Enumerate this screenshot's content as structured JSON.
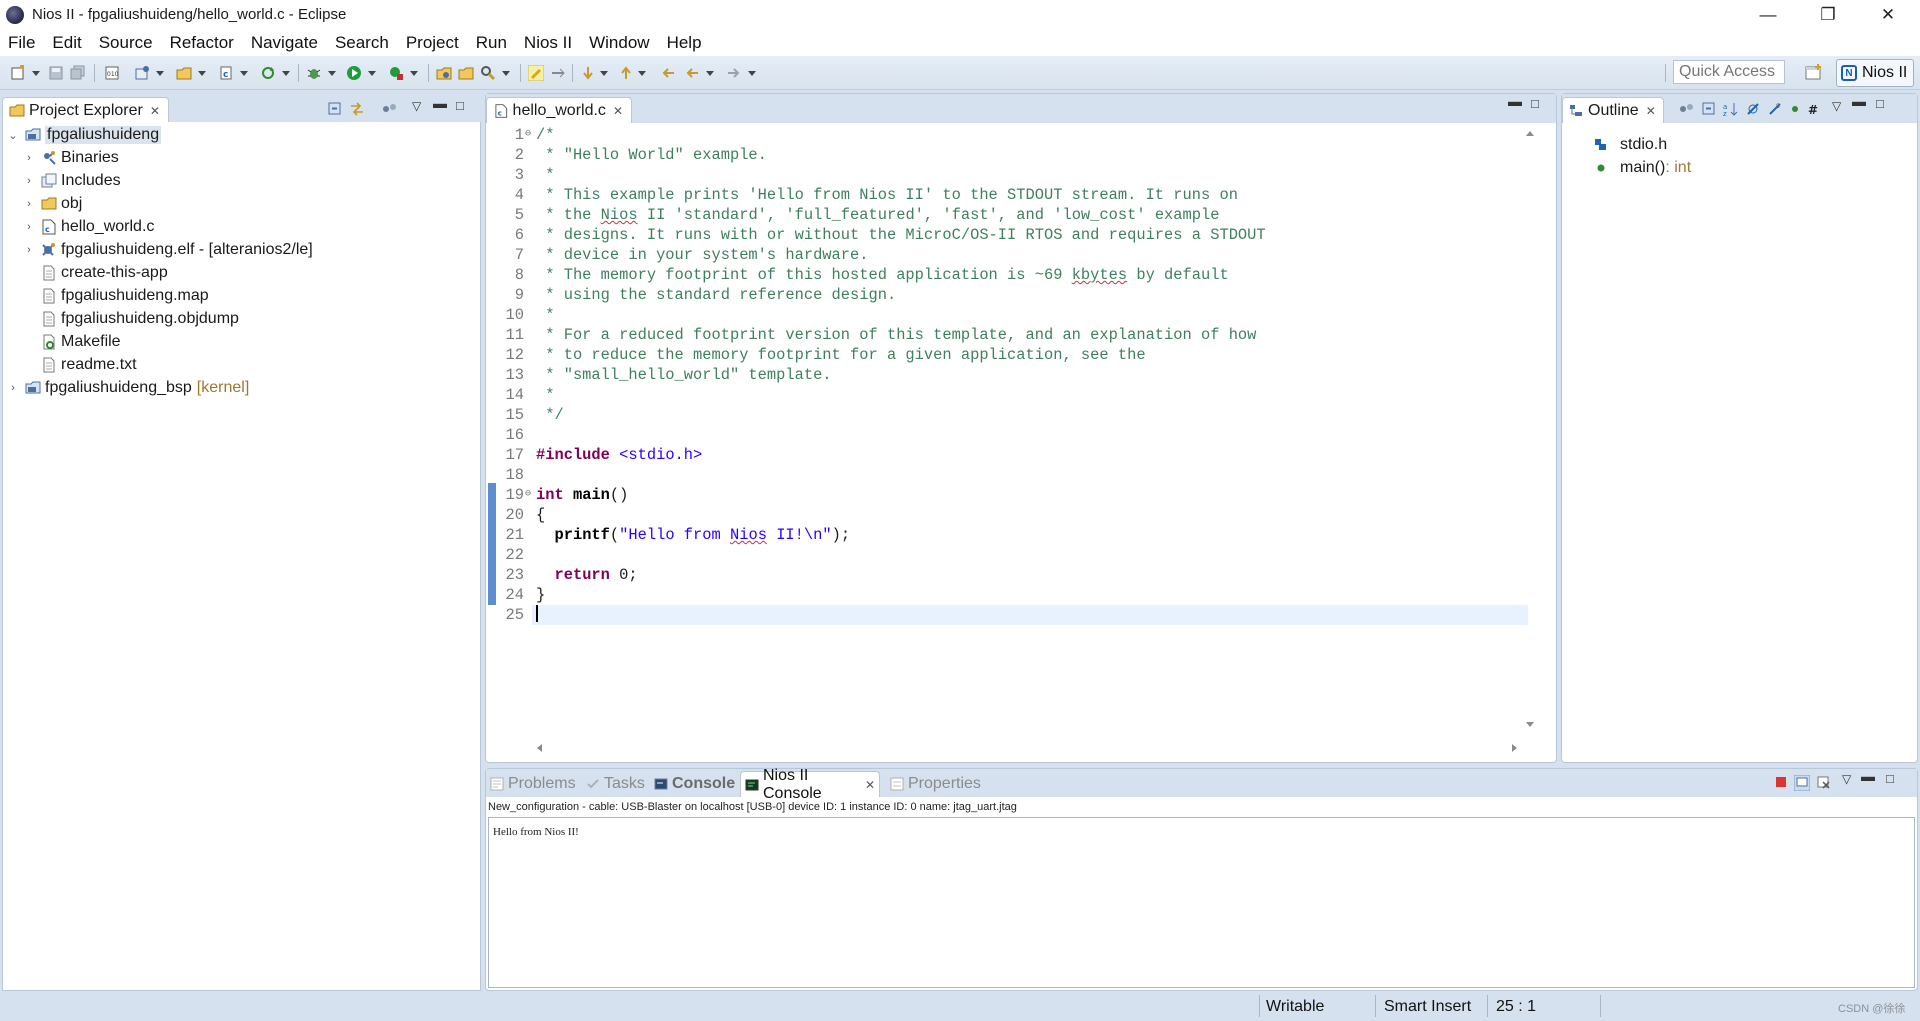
{
  "window": {
    "title": "Nios II - fpgaliushuideng/hello_world.c - Eclipse",
    "minimize": "—",
    "restore": "❐",
    "close": "✕"
  },
  "menu": [
    "File",
    "Edit",
    "Source",
    "Refactor",
    "Navigate",
    "Search",
    "Project",
    "Run",
    "Nios II",
    "Window",
    "Help"
  ],
  "toolbar": {
    "quick_access_placeholder": "Quick Access",
    "perspective_label": "Nios II",
    "perspective_icon_text": "N"
  },
  "project_explorer": {
    "title": "Project Explorer",
    "tree": [
      {
        "label": "fpgaliushuideng",
        "icon": "project-folder-icon",
        "expanded": true,
        "selected": true,
        "level": 0,
        "chevron": "⌄"
      },
      {
        "label": "Binaries",
        "icon": "binaries-icon",
        "level": 1,
        "chevron": "›"
      },
      {
        "label": "Includes",
        "icon": "includes-icon",
        "level": 1,
        "chevron": "›"
      },
      {
        "label": "obj",
        "icon": "folder-icon",
        "level": 1,
        "chevron": "›"
      },
      {
        "label": "hello_world.c",
        "icon": "c-file-icon",
        "level": 1,
        "chevron": "›"
      },
      {
        "label": "fpgaliushuideng.elf - [alteranios2/le]",
        "icon": "elf-icon",
        "level": 1,
        "chevron": "›"
      },
      {
        "label": "create-this-app",
        "icon": "file-icon",
        "level": 1,
        "chevron": ""
      },
      {
        "label": "fpgaliushuideng.map",
        "icon": "file-icon",
        "level": 1,
        "chevron": ""
      },
      {
        "label": "fpgaliushuideng.objdump",
        "icon": "file-icon",
        "level": 1,
        "chevron": ""
      },
      {
        "label": "Makefile",
        "icon": "makefile-icon",
        "level": 1,
        "chevron": ""
      },
      {
        "label": "readme.txt",
        "icon": "file-icon",
        "level": 1,
        "chevron": ""
      },
      {
        "label": "fpgaliushuideng_bsp",
        "suffix": "[kernel]",
        "icon": "project-folder-icon",
        "level": 0,
        "chevron": "›"
      }
    ]
  },
  "editor": {
    "tab_label": "hello_world.c",
    "cursor_line": 25,
    "lines": [
      [
        {
          "t": "/*",
          "c": "cmt"
        }
      ],
      [
        {
          "t": " * \"Hello World\" example.",
          "c": "cmt"
        }
      ],
      [
        {
          "t": " *",
          "c": "cmt"
        }
      ],
      [
        {
          "t": " * This example prints 'Hello from Nios II' to the STDOUT stream. It runs on",
          "c": "cmt"
        }
      ],
      [
        {
          "t": " * the ",
          "c": "cmt"
        },
        {
          "t": "Nios",
          "c": "cmt underline"
        },
        {
          "t": " II 'standard', 'full_featured', 'fast', and 'low_cost' example",
          "c": "cmt"
        }
      ],
      [
        {
          "t": " * designs. It runs with or without the MicroC/OS-II RTOS and requires a STDOUT",
          "c": "cmt"
        }
      ],
      [
        {
          "t": " * device in your system's hardware.",
          "c": "cmt"
        }
      ],
      [
        {
          "t": " * The memory footprint of this hosted application is ~69 ",
          "c": "cmt"
        },
        {
          "t": "kbytes",
          "c": "cmt underline"
        },
        {
          "t": " by default",
          "c": "cmt"
        }
      ],
      [
        {
          "t": " * using the standard reference design.",
          "c": "cmt"
        }
      ],
      [
        {
          "t": " *",
          "c": "cmt"
        }
      ],
      [
        {
          "t": " * For a reduced footprint version of this template, and an explanation of how",
          "c": "cmt"
        }
      ],
      [
        {
          "t": " * to reduce the memory footprint for a given application, see the",
          "c": "cmt"
        }
      ],
      [
        {
          "t": " * \"small_hello_world\" template.",
          "c": "cmt"
        }
      ],
      [
        {
          "t": " *",
          "c": "cmt"
        }
      ],
      [
        {
          "t": " */",
          "c": "cmt"
        }
      ],
      [],
      [
        {
          "t": "#include",
          "c": "kw"
        },
        {
          "t": " ",
          "c": ""
        },
        {
          "t": "<stdio.h>",
          "c": "inc"
        }
      ],
      [],
      [
        {
          "t": "int",
          "c": "kw"
        },
        {
          "t": " ",
          "c": ""
        },
        {
          "t": "main",
          "c": "fn"
        },
        {
          "t": "()",
          "c": ""
        }
      ],
      [
        {
          "t": "{",
          "c": ""
        }
      ],
      [
        {
          "t": "  ",
          "c": ""
        },
        {
          "t": "printf",
          "c": "fn"
        },
        {
          "t": "(",
          "c": ""
        },
        {
          "t": "\"Hello from ",
          "c": "str"
        },
        {
          "t": "Nios",
          "c": "str underline"
        },
        {
          "t": " II!\\n\"",
          "c": "str"
        },
        {
          "t": ");",
          "c": ""
        }
      ],
      [],
      [
        {
          "t": "  ",
          "c": ""
        },
        {
          "t": "return",
          "c": "kw"
        },
        {
          "t": " 0;",
          "c": ""
        }
      ],
      [
        {
          "t": "}",
          "c": ""
        }
      ],
      []
    ],
    "fold_lines": [
      1,
      19
    ]
  },
  "outline": {
    "title": "Outline",
    "items": [
      {
        "label": "stdio.h",
        "type": "",
        "icon": "include-icon"
      },
      {
        "label": "main()",
        "type": " : int",
        "icon": "function-icon"
      }
    ]
  },
  "console_area": {
    "tabs": [
      {
        "label": "Problems",
        "icon": "problems-icon",
        "active": false
      },
      {
        "label": "Tasks",
        "icon": "tasks-icon",
        "active": false
      },
      {
        "label": "Console",
        "icon": "console-icon",
        "active": false
      },
      {
        "label": "Nios II Console",
        "icon": "nios-console-icon",
        "active": true
      },
      {
        "label": "Properties",
        "icon": "properties-icon",
        "active": false
      }
    ],
    "description": "New_configuration - cable: USB-Blaster on localhost [USB-0] device ID: 1 instance ID: 0 name: jtag_uart.jtag",
    "output": "Hello from Nios II!"
  },
  "status_bar": {
    "writable": "Writable",
    "insert_mode": "Smart Insert",
    "position": "25 : 1"
  },
  "watermark": "CSDN @徐徐",
  "colors": {
    "chrome": "#d5e1ee",
    "comment": "#3f7f5f",
    "keyword": "#7f0055",
    "string": "#2a00ff",
    "current_line": "#e8f2fe",
    "change_bar": "#5b8fd0"
  }
}
